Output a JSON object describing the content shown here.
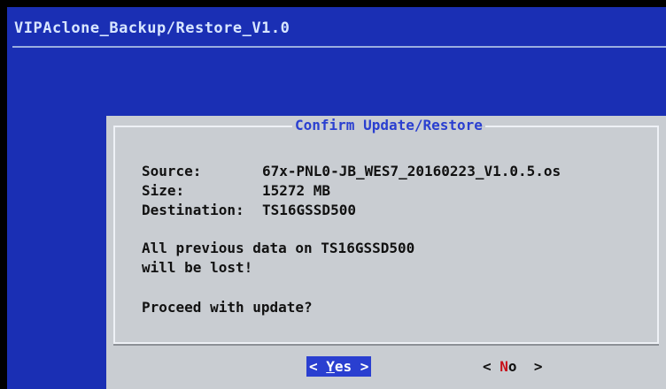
{
  "backtitle": "VIPAclone_Backup/Restore_V1.0",
  "dialog": {
    "title": "Confirm Update/Restore",
    "source_label": "Source:",
    "source_value": "67x-PNL0-JB_WES7_20160223_V1.0.5.os",
    "size_label": "Size:",
    "size_value": "15272 MB",
    "dest_label": "Destination:",
    "dest_value": "TS16GSSD500",
    "warning_line1": "All previous data on TS16GSSD500",
    "warning_line2": "will be lost!",
    "prompt": "Proceed with update?"
  },
  "buttons": {
    "yes": {
      "open": "< ",
      "hotkey": "Y",
      "rest": "es",
      "close": " >"
    },
    "no": {
      "open": "< ",
      "hotkey": "N",
      "rest": "o",
      "close": "  >"
    }
  },
  "colors": {
    "screen_bg": "#1a2fb4",
    "dialog_bg": "#c9cdd2",
    "title_text": "#2a3fd0",
    "selected_button_bg": "#2a3fd0",
    "hotkey_no": "#c8101a"
  }
}
